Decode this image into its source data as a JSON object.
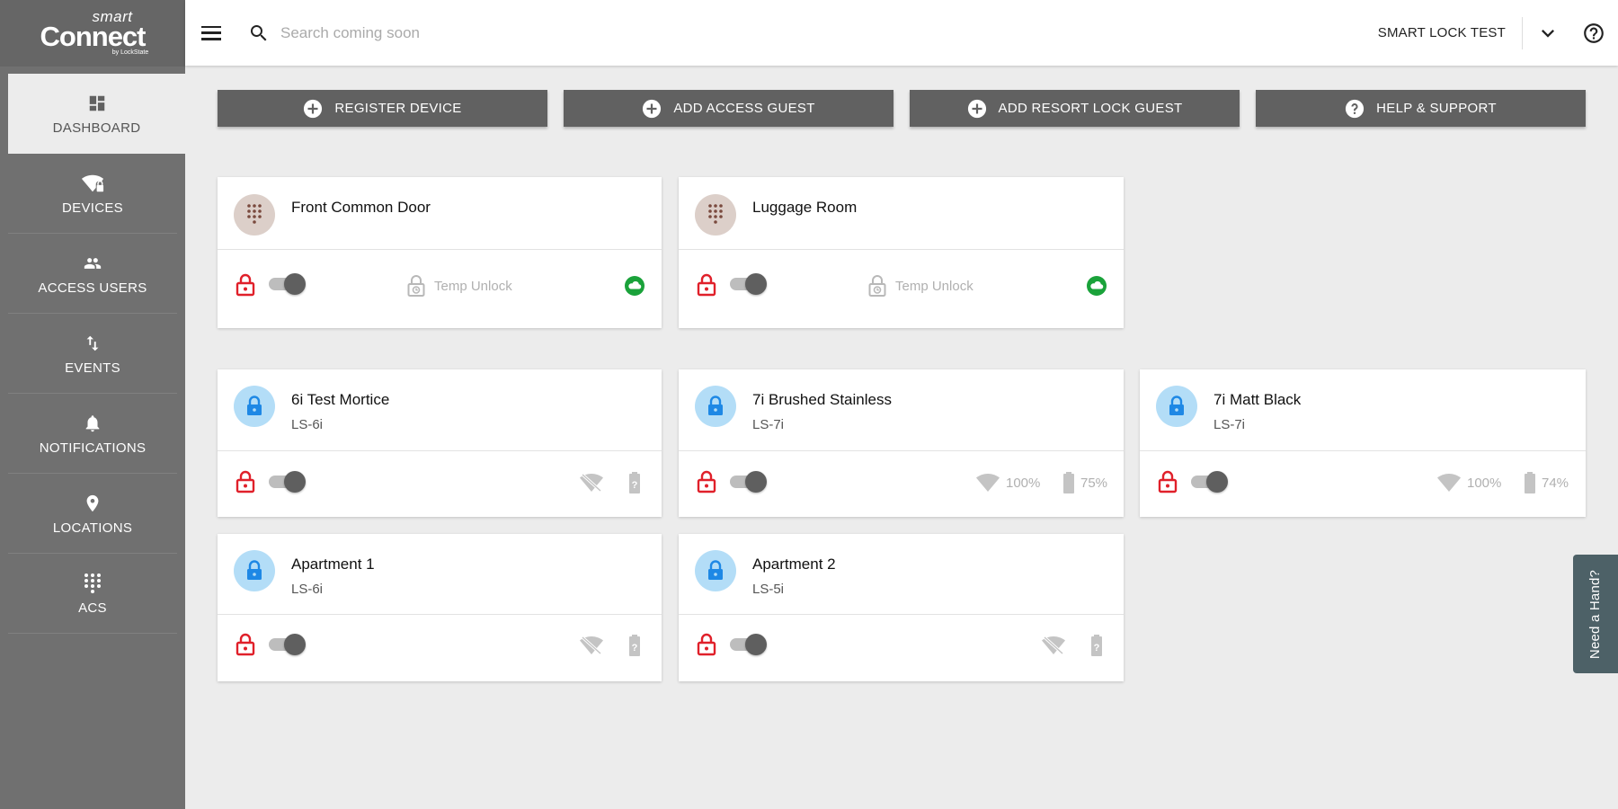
{
  "logo": {
    "small": "smart",
    "big": "Connect",
    "by": "by LockState"
  },
  "sidebar": {
    "items": [
      {
        "label": "DASHBOARD",
        "icon": "dashboard-icon"
      },
      {
        "label": "DEVICES",
        "icon": "wifi-lock-icon"
      },
      {
        "label": "ACCESS USERS",
        "icon": "people-icon"
      },
      {
        "label": "EVENTS",
        "icon": "swap-vert-icon"
      },
      {
        "label": "NOTIFICATIONS",
        "icon": "bell-icon"
      },
      {
        "label": "LOCATIONS",
        "icon": "location-pin-icon"
      },
      {
        "label": "ACS",
        "icon": "keypad-icon"
      }
    ]
  },
  "header": {
    "search_placeholder": "Search coming soon",
    "account": "SMART LOCK TEST"
  },
  "actions": [
    {
      "label": "REGISTER DEVICE",
      "icon": "add-circle-icon"
    },
    {
      "label": "ADD ACCESS GUEST",
      "icon": "add-circle-icon"
    },
    {
      "label": "ADD RESORT LOCK GUEST",
      "icon": "add-circle-icon"
    },
    {
      "label": "HELP & SUPPORT",
      "icon": "help-circle-icon"
    }
  ],
  "acs_cards": [
    {
      "title": "Front Common Door",
      "temp_unlock": "Temp Unlock",
      "status_icon": "cloud-online-icon"
    },
    {
      "title": "Luggage Room",
      "temp_unlock": "Temp Unlock",
      "status_icon": "cloud-online-icon"
    }
  ],
  "lock_cards": [
    {
      "title": "6i Test Mortice",
      "model": "LS-6i",
      "wifi": null,
      "battery": null
    },
    {
      "title": "7i Brushed Stainless",
      "model": "LS-7i",
      "wifi": "100%",
      "battery": "75%"
    },
    {
      "title": "7i Matt Black",
      "model": "LS-7i",
      "wifi": "100%",
      "battery": "74%"
    },
    {
      "title": "Apartment 1",
      "model": "LS-6i",
      "wifi": null,
      "battery": null
    },
    {
      "title": "Apartment 2",
      "model": "LS-5i",
      "wifi": null,
      "battery": null
    }
  ],
  "need_hand": "Need a Hand?",
  "colors": {
    "sidebar_bg": "#707070",
    "button_bg": "#616161",
    "lock_red": "#e0202a",
    "lock_blue": "#1e88e5",
    "online_green": "#1aa23a",
    "need_hand_bg": "#4d6167"
  }
}
